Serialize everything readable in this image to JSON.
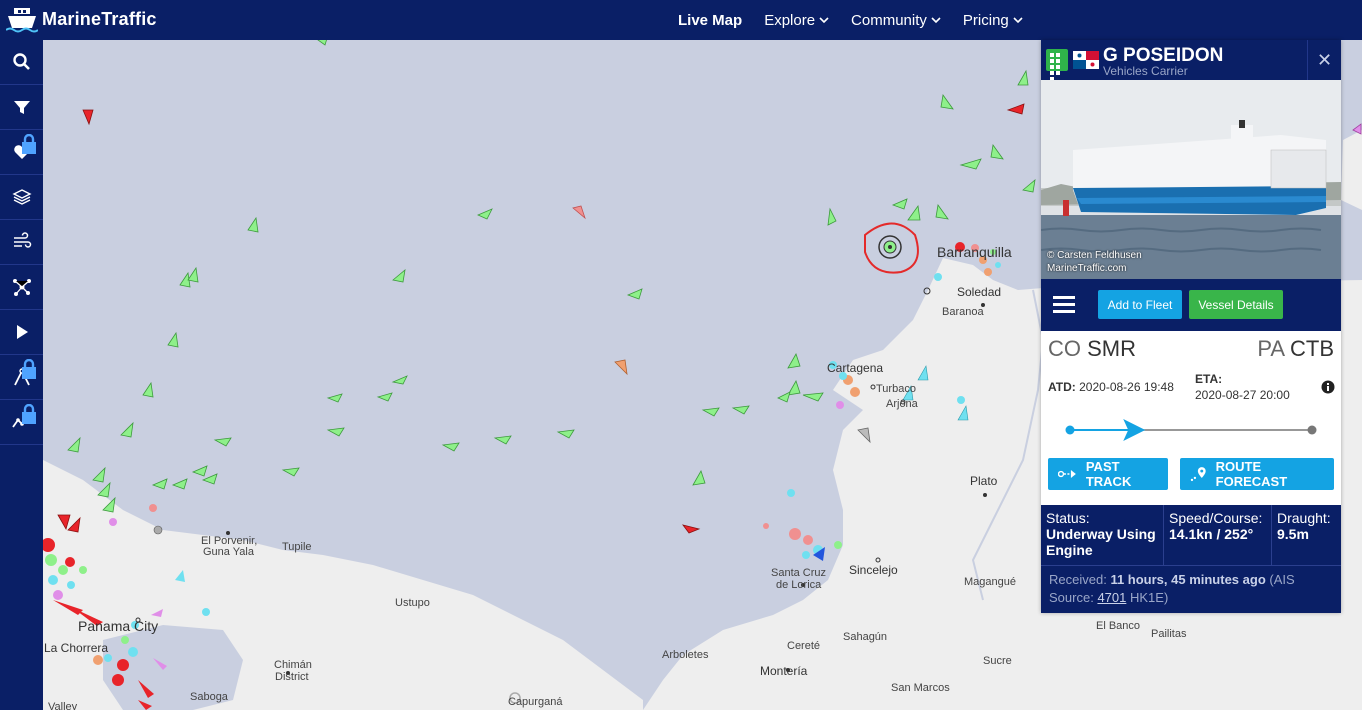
{
  "header": {
    "app_name": "MarineTraffic",
    "nav": [
      {
        "label": "Live Map",
        "active": true
      },
      {
        "label": "Explore",
        "dropdown": true
      },
      {
        "label": "Community",
        "dropdown": true
      },
      {
        "label": "Pricing",
        "dropdown": true
      }
    ]
  },
  "sidebar": {
    "items": [
      {
        "icon": "search-icon",
        "locked": false
      },
      {
        "icon": "filter-icon",
        "locked": false
      },
      {
        "icon": "heart-icon",
        "locked": true
      },
      {
        "icon": "layers-icon",
        "locked": false
      },
      {
        "icon": "wind-icon",
        "locked": false
      },
      {
        "icon": "network-icon",
        "locked": false
      },
      {
        "icon": "play-icon",
        "locked": false
      },
      {
        "icon": "compass-icon",
        "locked": true
      },
      {
        "icon": "analytics-icon",
        "locked": true
      }
    ]
  },
  "map": {
    "places": [
      {
        "label": "Barranquilla"
      },
      {
        "label": "Soledad"
      },
      {
        "label": "Baranoa"
      },
      {
        "label": "Cartagena"
      },
      {
        "label": "Turbaco"
      },
      {
        "label": "Arjona"
      },
      {
        "label": "Plato"
      },
      {
        "label": "Santa Cruz"
      },
      {
        "label": "de Lorica"
      },
      {
        "label": "Sincelejo"
      },
      {
        "label": "Magangué"
      },
      {
        "label": "Cereté"
      },
      {
        "label": "Montería"
      },
      {
        "label": "Sahagún"
      },
      {
        "label": "Sucre"
      },
      {
        "label": "El Banco"
      },
      {
        "label": "Pailitas"
      },
      {
        "label": "San Marcos"
      },
      {
        "label": "Arboletes"
      },
      {
        "label": "Capurganá"
      },
      {
        "label": "El Porvenir,"
      },
      {
        "label": "Guna Yala"
      },
      {
        "label": "Tupile"
      },
      {
        "label": "Ustupo"
      },
      {
        "label": "Panama City"
      },
      {
        "label": "La Chorrera"
      },
      {
        "label": "Chimán"
      },
      {
        "label": "District"
      },
      {
        "label": "Saboga"
      },
      {
        "label": "Valley"
      }
    ]
  },
  "vessel": {
    "name": "G POSEIDON",
    "type": "Vehicles Carrier",
    "photo_credit_1": "© Carsten Feldhusen",
    "photo_credit_2": "MarineTraffic.com",
    "add_to_fleet": "Add to Fleet",
    "vessel_details": "Vessel Details",
    "origin_country": "CO",
    "origin_port": "SMR",
    "dest_country": "PA",
    "dest_port": "CTB",
    "atd_label": "ATD:",
    "atd_value": "2020-08-26 19:48",
    "eta_label": "ETA:",
    "eta_value": "2020-08-27 20:00",
    "progress": 0.22,
    "past_track": "PAST TRACK",
    "route_forecast": "ROUTE FORECAST",
    "status_label": "Status:",
    "status_value": "Underway Using Engine",
    "speed_label": "Speed/Course:",
    "speed_value": "14.1kn / 252°",
    "draught_label": "Draught:",
    "draught_value": "9.5m",
    "received_label": "Received:",
    "received_value": "11 hours, 45 minutes ago",
    "received_source_pre": "(AIS Source:",
    "received_source_id": "4701",
    "received_source_post": "HK1E)"
  },
  "colors": {
    "navy": "#0a1f66",
    "sea": "#c9cfe0",
    "land": "#eeeeee",
    "vessel_green": "#8ef08a",
    "accent_blue": "#14a3e3",
    "accent_green": "#39b54a"
  }
}
